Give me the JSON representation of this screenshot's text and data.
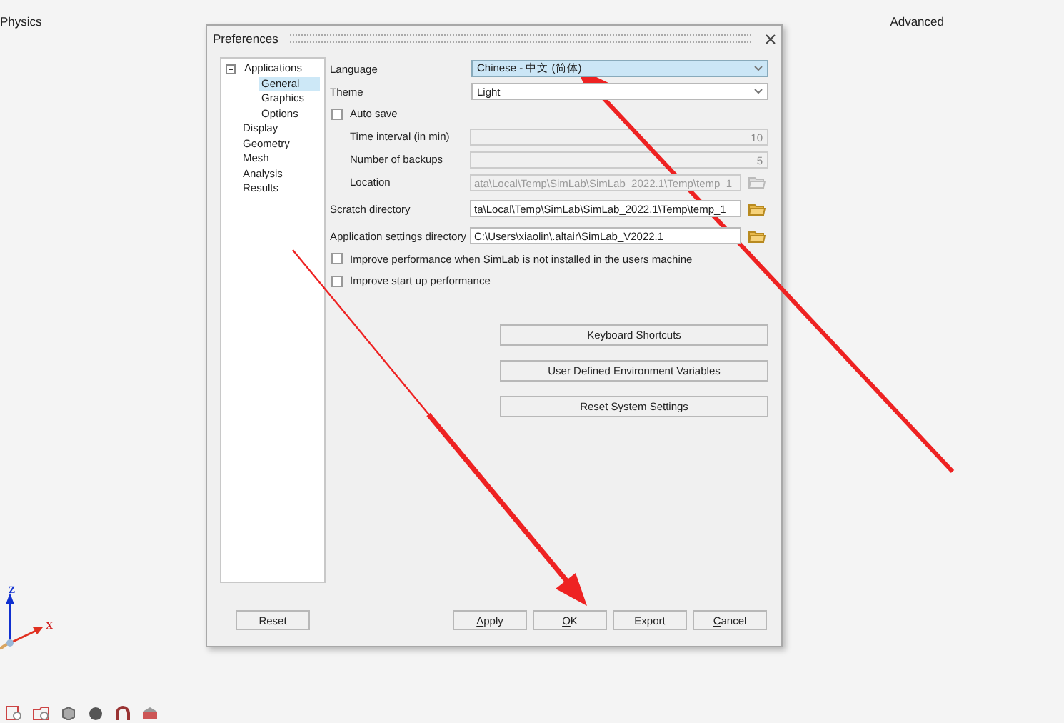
{
  "background_labels": [
    "Physics",
    "Advanced"
  ],
  "dialog": {
    "title": "Preferences",
    "tree": [
      {
        "label": "Applications",
        "expanded": true,
        "selected": false,
        "children": [
          {
            "label": "General",
            "selected": true
          },
          {
            "label": "Graphics",
            "selected": false
          },
          {
            "label": "Options",
            "selected": false
          }
        ]
      },
      {
        "label": "Display",
        "selected": false
      },
      {
        "label": "Geometry",
        "selected": false
      },
      {
        "label": "Mesh",
        "selected": false
      },
      {
        "label": "Analysis",
        "selected": false
      },
      {
        "label": "Results",
        "selected": false
      }
    ],
    "settings": [
      {
        "kind": "dropdown",
        "label": "Language",
        "value": "Chinese - 中文 (简体)",
        "focused": true
      },
      {
        "kind": "dropdown",
        "label": "Theme",
        "value": "Light",
        "focused": false
      },
      {
        "kind": "checkbox",
        "label": "Auto save",
        "checked": false
      },
      {
        "kind": "number",
        "label": "Time interval (in min)",
        "value": "10",
        "disabled": true
      },
      {
        "kind": "number",
        "label": "Number of backups",
        "value": "5",
        "disabled": true
      },
      {
        "kind": "sub_path",
        "label": "Location",
        "value": "ata\\Local\\Temp\\SimLab\\SimLab_2022.1\\Temp\\temp_1",
        "disabled": true
      },
      {
        "kind": "path",
        "label": "Scratch directory",
        "value": "ta\\Local\\Temp\\SimLab\\SimLab_2022.1\\Temp\\temp_1",
        "disabled": false
      },
      {
        "kind": "path",
        "label": "Application settings directory",
        "value": "C:\\Users\\xiaolin\\.altair\\SimLab_V2022.1",
        "disabled": false
      },
      {
        "kind": "checkbox",
        "label": "Improve performance when SimLab is not installed in the users machine",
        "checked": false
      },
      {
        "kind": "checkbox",
        "label": "Improve start up performance",
        "checked": false
      }
    ],
    "action_buttons": [
      "Keyboard Shortcuts",
      "User Defined Environment Variables",
      "Reset System Settings"
    ],
    "reset_button": "Reset",
    "footer_buttons": [
      {
        "label": "Apply",
        "underline_first": true
      },
      {
        "label": "OK",
        "underline_first": true
      },
      {
        "label": "Export",
        "underline_first": false
      },
      {
        "label": "Cancel",
        "underline_first": true
      }
    ]
  },
  "axis_labels": {
    "vertical": "Z",
    "horizontal": "X"
  }
}
